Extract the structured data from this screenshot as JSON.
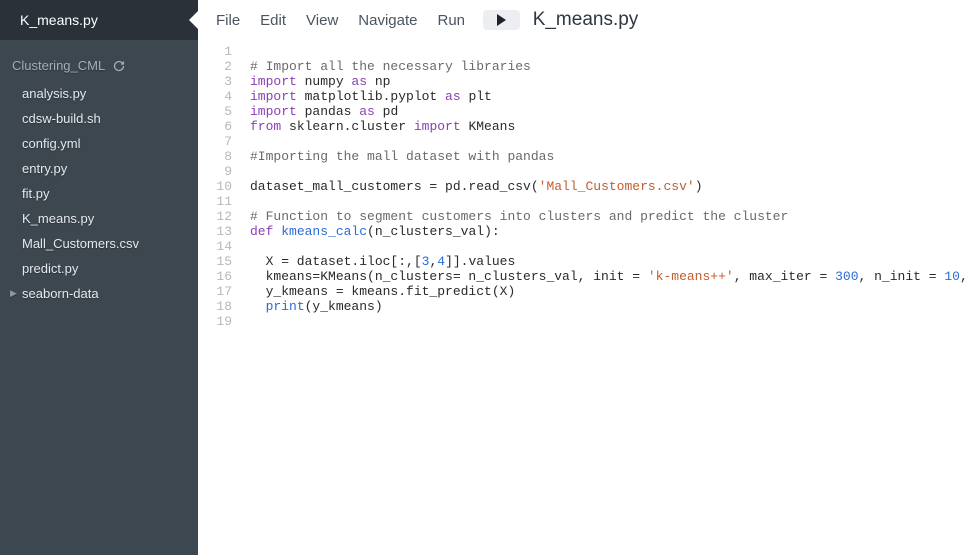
{
  "tab": {
    "active_file": "K_means.py"
  },
  "project": {
    "name": "Clustering_CML"
  },
  "files": [
    {
      "name": "analysis.py",
      "type": "file"
    },
    {
      "name": "cdsw-build.sh",
      "type": "file"
    },
    {
      "name": "config.yml",
      "type": "file"
    },
    {
      "name": "entry.py",
      "type": "file"
    },
    {
      "name": "fit.py",
      "type": "file"
    },
    {
      "name": "K_means.py",
      "type": "file"
    },
    {
      "name": "Mall_Customers.csv",
      "type": "file"
    },
    {
      "name": "predict.py",
      "type": "file"
    },
    {
      "name": "seaborn-data",
      "type": "folder"
    }
  ],
  "menu": {
    "file": "File",
    "edit": "Edit",
    "view": "View",
    "navigate": "Navigate",
    "run": "Run"
  },
  "title": "K_means.py",
  "code": {
    "lines": [
      {
        "n": 1,
        "tokens": []
      },
      {
        "n": 2,
        "tokens": [
          {
            "t": "# Import all the necessary libraries",
            "c": "comment"
          }
        ]
      },
      {
        "n": 3,
        "tokens": [
          {
            "t": "import",
            "c": "kw"
          },
          {
            "t": " numpy "
          },
          {
            "t": "as",
            "c": "kw"
          },
          {
            "t": " np"
          }
        ]
      },
      {
        "n": 4,
        "tokens": [
          {
            "t": "import",
            "c": "kw"
          },
          {
            "t": " matplotlib.pyplot "
          },
          {
            "t": "as",
            "c": "kw"
          },
          {
            "t": " plt"
          }
        ]
      },
      {
        "n": 5,
        "tokens": [
          {
            "t": "import",
            "c": "kw"
          },
          {
            "t": " pandas "
          },
          {
            "t": "as",
            "c": "kw"
          },
          {
            "t": " pd"
          }
        ]
      },
      {
        "n": 6,
        "tokens": [
          {
            "t": "from",
            "c": "kw"
          },
          {
            "t": " sklearn.cluster "
          },
          {
            "t": "import",
            "c": "kw"
          },
          {
            "t": " KMeans"
          }
        ]
      },
      {
        "n": 7,
        "tokens": []
      },
      {
        "n": 8,
        "tokens": [
          {
            "t": "#Importing the mall dataset with pandas",
            "c": "comment"
          }
        ]
      },
      {
        "n": 9,
        "tokens": []
      },
      {
        "n": 10,
        "tokens": [
          {
            "t": "dataset_mall_customers = pd.read_csv("
          },
          {
            "t": "'Mall_Customers.csv'",
            "c": "str"
          },
          {
            "t": ")"
          }
        ]
      },
      {
        "n": 11,
        "tokens": []
      },
      {
        "n": 12,
        "tokens": [
          {
            "t": "# Function to segment customers into clusters and predict the cluster",
            "c": "comment"
          }
        ]
      },
      {
        "n": 13,
        "tokens": [
          {
            "t": "def",
            "c": "kw"
          },
          {
            "t": " "
          },
          {
            "t": "kmeans_calc",
            "c": "fn"
          },
          {
            "t": "(n_clusters_val):"
          }
        ]
      },
      {
        "n": 14,
        "tokens": []
      },
      {
        "n": 15,
        "tokens": [
          {
            "t": "  X = dataset.iloc[:,["
          },
          {
            "t": "3",
            "c": "num"
          },
          {
            "t": ","
          },
          {
            "t": "4",
            "c": "num"
          },
          {
            "t": "]].values"
          }
        ]
      },
      {
        "n": 16,
        "tokens": [
          {
            "t": "  kmeans=KMeans(n_clusters= n_clusters_val, init = "
          },
          {
            "t": "'k-means++'",
            "c": "str"
          },
          {
            "t": ", max_iter = "
          },
          {
            "t": "300",
            "c": "num"
          },
          {
            "t": ", n_init = "
          },
          {
            "t": "10",
            "c": "num"
          },
          {
            "t": ","
          }
        ]
      },
      {
        "n": 17,
        "tokens": [
          {
            "t": "  y_kmeans = kmeans.fit_predict(X)"
          }
        ]
      },
      {
        "n": 18,
        "tokens": [
          {
            "t": "  "
          },
          {
            "t": "print",
            "c": "fn"
          },
          {
            "t": "(y_kmeans)"
          }
        ]
      },
      {
        "n": 19,
        "tokens": []
      }
    ]
  }
}
